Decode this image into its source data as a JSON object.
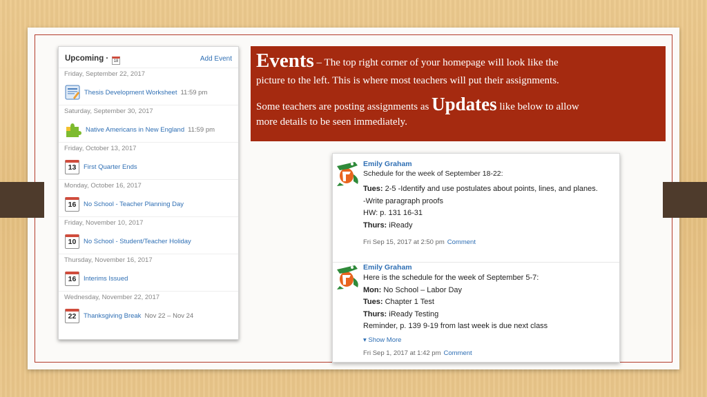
{
  "upcoming": {
    "title": "Upcoming ·",
    "add_event": "Add Event",
    "calendar_icon_num": "18",
    "groups": [
      {
        "date": "Friday, September 22, 2017",
        "icon": "document-icon",
        "icon_text": "",
        "title": "Thesis Development Worksheet",
        "time": "11:59 pm"
      },
      {
        "date": "Saturday, September 30, 2017",
        "icon": "puzzle-icon",
        "icon_text": "",
        "title": "Native Americans in New England",
        "time": "11:59 pm"
      },
      {
        "date": "Friday, October 13, 2017",
        "icon": "calendar-icon",
        "icon_text": "13",
        "title": "First Quarter Ends",
        "time": ""
      },
      {
        "date": "Monday, October 16, 2017",
        "icon": "calendar-icon",
        "icon_text": "16",
        "title": "No School - Teacher Planning Day",
        "time": ""
      },
      {
        "date": "Friday, November 10, 2017",
        "icon": "calendar-icon",
        "icon_text": "10",
        "title": "No School - Student/Teacher Holiday",
        "time": ""
      },
      {
        "date": "Thursday, November 16, 2017",
        "icon": "calendar-icon",
        "icon_text": "16",
        "title": "Interims Issued",
        "time": ""
      },
      {
        "date": "Wednesday, November 22, 2017",
        "icon": "calendar-icon",
        "icon_text": "22",
        "title": "Thanksgiving Break",
        "time": "Nov 22 – Nov 24"
      }
    ]
  },
  "events_box": {
    "title": "Events",
    "line1_rest": " – The top right corner of your homepage will look like the",
    "line2": "picture to the left.  This is where most teachers will put their assignments.",
    "line3_pre": "Some teachers are posting assignments as ",
    "updates_word": "Updates",
    "line3_post": " like below to allow",
    "line4": "more details to be seen immediately."
  },
  "updates_panel": {
    "post1": {
      "author": "Emily Graham",
      "subtitle": "Schedule for the week of September 18-22:",
      "l1_bold": "Tues:",
      "l1_text": " 2-5 -Identify and use postulates about points, lines, and planes.",
      "l2_text": "-Write paragraph proofs",
      "l3_text": "HW: p. 131 16-31",
      "l4_bold": "Thurs:",
      "l4_text": " iReady",
      "meta": "Fri Sep 15, 2017 at 2:50 pm",
      "comment": "Comment"
    },
    "post2": {
      "author": "Emily Graham",
      "l0_text": "Here is the schedule for the week of September 5-7:",
      "l1_bold": "Mon:",
      "l1_text": " No School – Labor Day",
      "l2_bold": "Tues:",
      "l2_text": " Chapter 1 Test",
      "l3_bold": "Thurs:",
      "l3_text": " iReady Testing",
      "l4_text": "Reminder, p. 139 9-19 from last week is due next class",
      "show_more": "▾  Show More",
      "meta": "Fri Sep 1, 2017 at 1:42 pm",
      "comment": "Comment"
    }
  },
  "colors": {
    "accent_red": "#a52a10",
    "link_blue": "#2f6fb4",
    "background_wood": "#e8c487"
  }
}
